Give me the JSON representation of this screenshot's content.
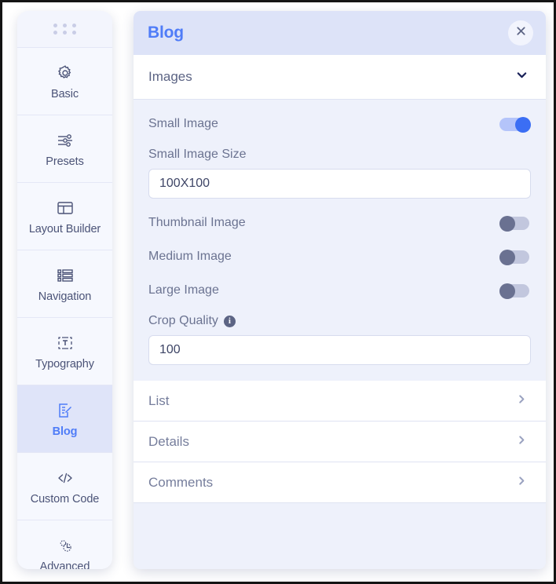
{
  "sidebar": {
    "drag_handle": "drag-handle-dots",
    "items": [
      {
        "label": "Basic",
        "icon": "gear-icon",
        "active": false
      },
      {
        "label": "Presets",
        "icon": "sliders-icon",
        "active": false
      },
      {
        "label": "Layout Builder",
        "icon": "layout-icon",
        "active": false
      },
      {
        "label": "Navigation",
        "icon": "list-icon",
        "active": false
      },
      {
        "label": "Typography",
        "icon": "text-box-icon",
        "active": false
      },
      {
        "label": "Blog",
        "icon": "document-edit-icon",
        "active": true
      },
      {
        "label": "Custom Code",
        "icon": "code-icon",
        "active": false
      },
      {
        "label": "Advanced",
        "icon": "settings-gears-icon",
        "active": false
      }
    ]
  },
  "panel": {
    "title": "Blog",
    "close_icon": "close-icon",
    "section": {
      "label": "Images",
      "chevron_icon": "chevron-down-icon",
      "expanded": true,
      "fields": {
        "small_image": {
          "label": "Small Image",
          "state": "on"
        },
        "small_image_size": {
          "label": "Small Image Size",
          "value": "100X100"
        },
        "thumbnail_image": {
          "label": "Thumbnail Image",
          "state": "off"
        },
        "medium_image": {
          "label": "Medium Image",
          "state": "off"
        },
        "large_image": {
          "label": "Large Image",
          "state": "off"
        },
        "crop_quality": {
          "label": "Crop Quality",
          "value": "100",
          "info_icon": "info-icon"
        }
      }
    },
    "rows": [
      {
        "label": "List",
        "chevron_icon": "chevron-right-icon"
      },
      {
        "label": "Details",
        "chevron_icon": "chevron-right-icon"
      },
      {
        "label": "Comments",
        "chevron_icon": "chevron-right-icon"
      }
    ]
  },
  "colors": {
    "accent_blue": "#4f7cf8",
    "toggle_on": "#3b6ef4",
    "toggle_off": "#6a7191",
    "panel_bg": "#eef1fb",
    "header_bg": "#dde3f8",
    "active_item_bg": "#dfe4f9"
  }
}
